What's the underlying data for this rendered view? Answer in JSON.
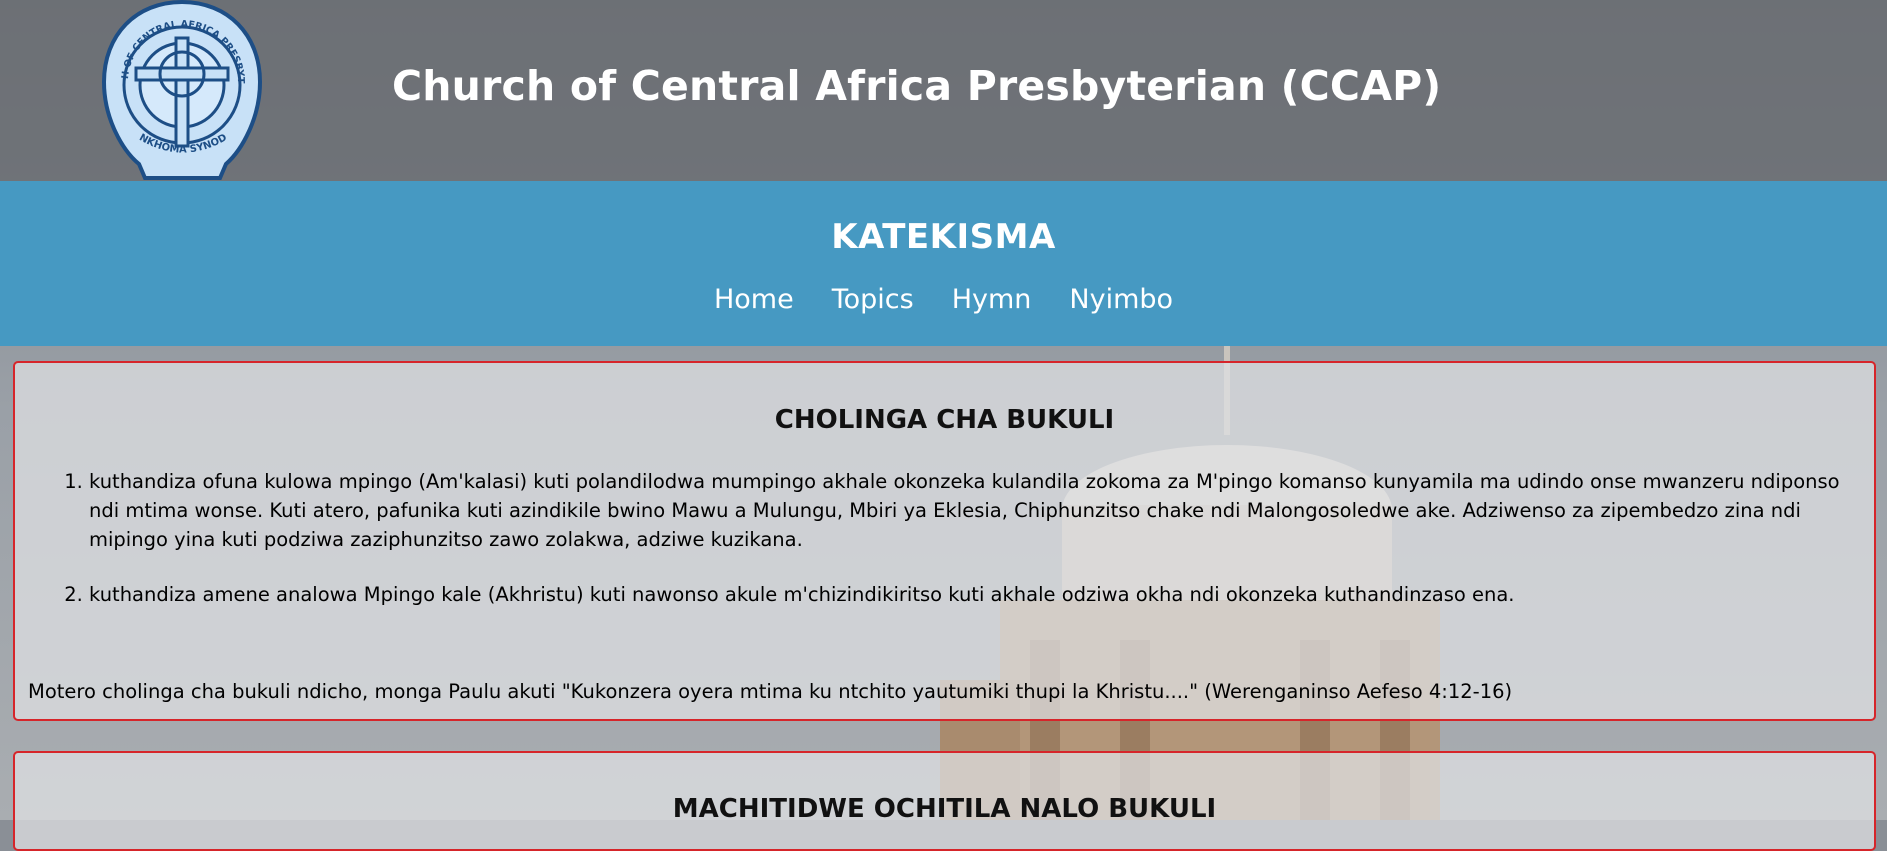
{
  "header": {
    "title": "Church of Central Africa Presbyterian (CCAP)",
    "logo": {
      "top_text": "CHURCH OF CENTRAL AFRICA PRESBYTERIAN",
      "bottom_text": "NKHOMA SYNOD"
    }
  },
  "nav": {
    "title": "KATEKISMA",
    "links": [
      "Home",
      "Topics",
      "Hymn",
      "Nyimbo"
    ]
  },
  "sections": [
    {
      "heading": "CHOLINGA CHA BUKULI",
      "items": [
        "kuthandiza ofuna kulowa mpingo (Am'kalasi) kuti polandilodwa mumpingo akhale okonzeka kulandila zokoma za M'pingo komanso kunyamila ma udindo onse mwanzeru ndiponso ndi mtima wonse. Kuti atero, pafunika kuti azindikile bwino Mawu a Mulungu, Mbiri ya Eklesia, Chiphunzitso chake ndi Malongosoledwe ake. Adziwenso za zipembedzo zina ndi mipingo yina kuti podziwa zaziphunzitso zawo zolakwa, adziwe kuzikana.",
        "kuthandiza amene analowa Mpingo kale (Akhristu) kuti nawonso akule m'chizindikiritso kuti akhale odziwa okha ndi okonzeka kuthandinzaso ena."
      ],
      "note": "Motero cholinga cha bukuli ndicho, monga Paulu akuti \"Kukonzera oyera mtima ku ntchito yautumiki thupi la Khristu....\" (Werenganinso Aefeso 4:12-16)"
    },
    {
      "heading": "MACHITIDWE OCHITILA NALO BUKULI"
    }
  ],
  "colors": {
    "header_bg": "#696c72",
    "nav_bg": "#4699c2",
    "card_border": "#d6252a",
    "logo_blue": "#c8e1f7",
    "logo_dark": "#1d4e86"
  }
}
